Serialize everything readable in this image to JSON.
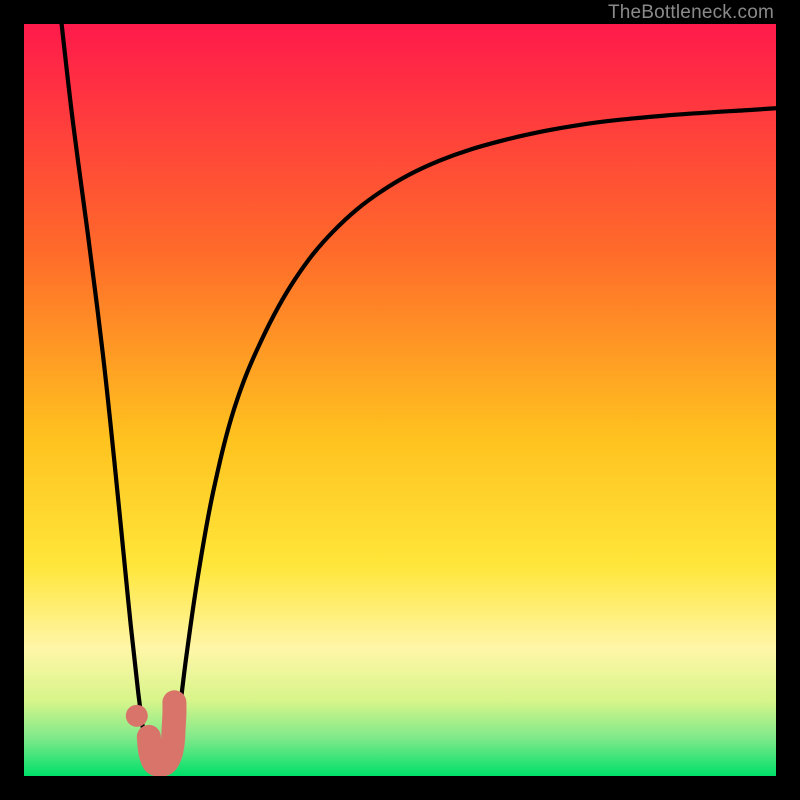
{
  "watermark": "TheBottleneck.com",
  "chart_data": {
    "type": "line",
    "title": "",
    "xlabel": "",
    "ylabel": "",
    "xlim": [
      0,
      100
    ],
    "ylim": [
      0,
      100
    ],
    "grid": false,
    "legend": false,
    "background_gradient": [
      "#ff1a4b",
      "#ff9a1f",
      "#ffe63a",
      "#fff6a8",
      "#00e06a"
    ],
    "series": [
      {
        "name": "left-branch",
        "type": "line",
        "x": [
          5.0,
          6.5,
          8.5,
          10.5,
          12.0,
          13.2,
          14.2,
          15.2,
          16.0,
          16.6
        ],
        "y": [
          100,
          87,
          72,
          56,
          42,
          30,
          20,
          11,
          5,
          1.5
        ]
      },
      {
        "name": "right-branch",
        "type": "line",
        "x": [
          19.8,
          20.5,
          21.6,
          23.2,
          25.2,
          28.0,
          31.6,
          36.0,
          41.2,
          47.6,
          55.2,
          64.0,
          74.0,
          85.0,
          97.0,
          100.0
        ],
        "y": [
          1.5,
          7,
          16,
          27,
          38,
          49,
          58,
          66,
          72.5,
          77.8,
          81.8,
          84.6,
          86.6,
          87.8,
          88.6,
          88.8
        ]
      },
      {
        "name": "pink-marker",
        "type": "scatter",
        "x": [
          15.0
        ],
        "y": [
          8.0
        ]
      },
      {
        "name": "pink-j-stroke",
        "type": "line",
        "x": [
          16.6,
          16.8,
          17.3,
          18.1,
          18.9,
          19.5,
          19.8,
          19.9,
          20.0,
          20.0
        ],
        "y": [
          5.2,
          3.2,
          1.8,
          1.5,
          1.8,
          3.0,
          4.6,
          6.4,
          8.2,
          9.8
        ]
      }
    ]
  },
  "colors": {
    "curve": "#000000",
    "marker": "#d9746b",
    "pink_stroke": "#d9746b"
  }
}
